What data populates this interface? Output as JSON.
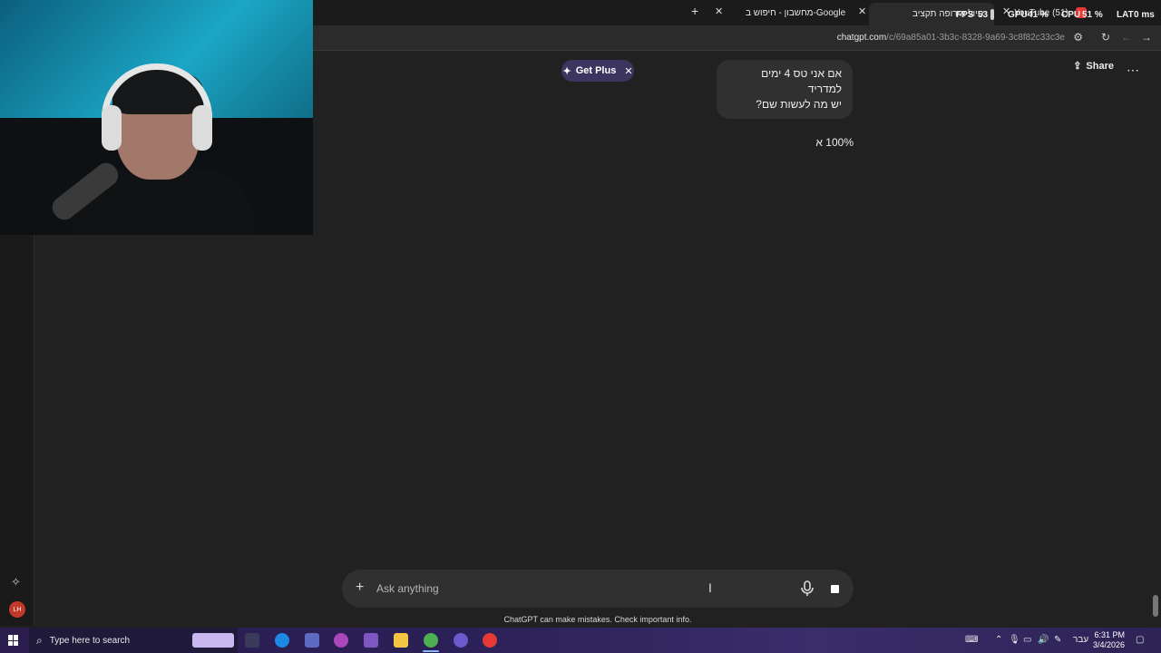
{
  "browser": {
    "tabs": [
      {
        "label": "YouTube (51)"
      },
      {
        "label": "טיול אירופה תקציב"
      },
      {
        "label": "מחשבון - חיפוש ב-Google"
      }
    ],
    "url_domain": "chatgpt.com",
    "url_path": "/c/69a85a01-3b3c-8328-9a69-3c8f82c33c3e"
  },
  "overlay_stats": {
    "fps_label": "FPS",
    "fps_value": "53",
    "gpu_label": "GPU",
    "gpu_value": "41 %",
    "cpu_label": "CPU",
    "cpu_value": "51 %",
    "lat_label": "LAT",
    "lat_value": "0 ms"
  },
  "chat": {
    "get_plus_label": "Get Plus",
    "share_label": "Share",
    "user_message_line1": "אם אני טס 4 ימים למדריד",
    "user_message_line2": "יש מה לעשות שם?",
    "assistant_message": "100% א",
    "composer_placeholder": "Ask anything",
    "disclaimer": "ChatGPT can make mistakes. Check important info."
  },
  "sidebar": {
    "avatar_initials": "LH"
  },
  "taskbar": {
    "search_placeholder": "Type here to search",
    "language": "עבר",
    "time": "6:31 PM",
    "date": "3/4/2026"
  },
  "colors": {
    "background": "#212121",
    "get_plus_bg": "#3b3560",
    "taskbar": "#2b2057",
    "avatar": "#c0392b"
  }
}
